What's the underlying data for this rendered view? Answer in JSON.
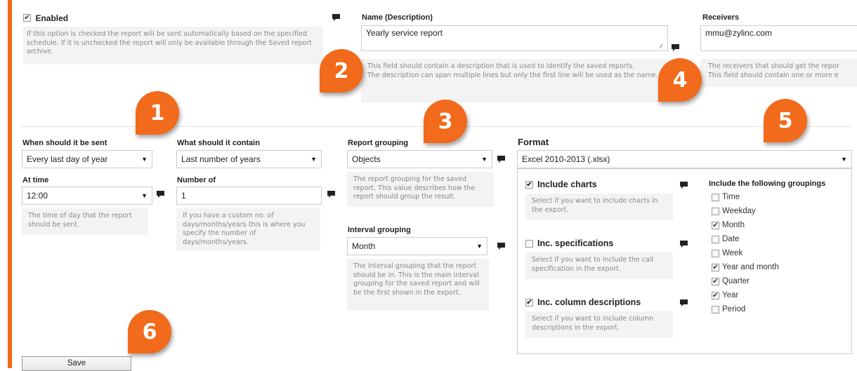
{
  "enabled": {
    "label": "Enabled",
    "checked": true,
    "help": "If this option is checked the report will be sent automatically based on the specified schedule. If it is unchecked the report will only be available through the Saved report archive."
  },
  "name": {
    "label": "Name (Description)",
    "value": "Yearly service report",
    "help": "This field should contain a description that is used to identify the saved reports.\nThe description can span multiple lines but only the first line will be used as the name."
  },
  "receivers": {
    "label": "Receivers",
    "value": "mmu@zylinc.com",
    "help": "The receivers that should get the repor\nThis field should contain one or more e"
  },
  "when_sent": {
    "label": "When should it be sent",
    "value": "Every last day of year"
  },
  "at_time": {
    "label": "At time",
    "value": "12:00",
    "help": "The time of day that the report should be sent."
  },
  "contain": {
    "label": "What should it contain",
    "value": "Last number of years"
  },
  "number_of": {
    "label": "Number of",
    "value": "1",
    "help": "If you have a custom no. of days/months/years this is where you specify the number of days/months/years."
  },
  "report_grouping": {
    "label": "Report grouping",
    "value": "Objects",
    "help": "The report grouping for the saved report. This value describes how the report should group the result."
  },
  "interval_grouping": {
    "label": "Interval grouping",
    "value": "Month",
    "help": "The interval grouping that the report should be in. This is the main interval grouping for the saved report and will be the first shown in the export."
  },
  "format": {
    "label": "Format",
    "value": "Excel 2010-2013 (.xlsx)",
    "include_charts": {
      "label": "Include charts",
      "checked": true,
      "help": "Select if you want to include charts in the export."
    },
    "inc_specifications": {
      "label": "Inc. specifications",
      "checked": false,
      "help": "Select if you want to include the call specification in the export."
    },
    "inc_column_descriptions": {
      "label": "Inc. column descriptions",
      "checked": true,
      "help": "Select if you want to include column descriptions in the export."
    },
    "groupings_label": "Include the following groupings",
    "groupings": [
      {
        "label": "Time",
        "checked": false
      },
      {
        "label": "Weekday",
        "checked": false
      },
      {
        "label": "Month",
        "checked": true
      },
      {
        "label": "Date",
        "checked": false
      },
      {
        "label": "Week",
        "checked": false
      },
      {
        "label": "Year and month",
        "checked": true
      },
      {
        "label": "Quarter",
        "checked": true
      },
      {
        "label": "Year",
        "checked": true
      },
      {
        "label": "Period",
        "checked": false
      }
    ]
  },
  "save_label": "Save",
  "callouts": [
    "1",
    "2",
    "3",
    "4",
    "5",
    "6"
  ],
  "colors": {
    "accent": "#f26a1b"
  }
}
